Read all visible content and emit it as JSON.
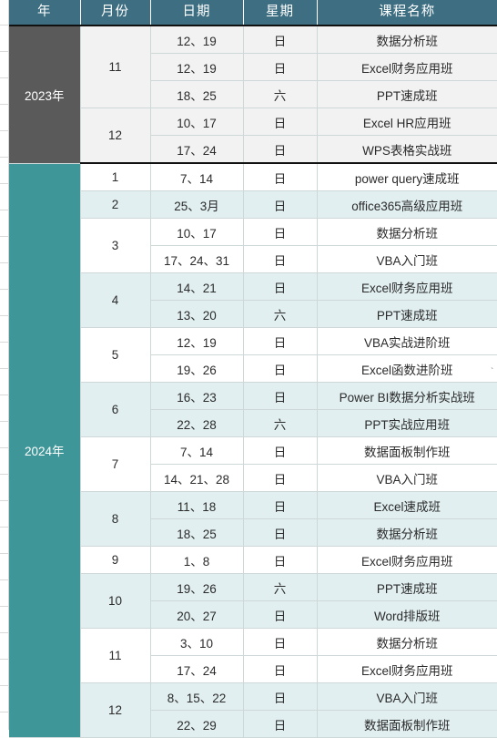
{
  "table": {
    "headers": [
      "年",
      "月份",
      "日期",
      "星期",
      "课程名称"
    ],
    "year_groups": [
      {
        "year_label": "2023年",
        "style": "gray",
        "months": [
          {
            "month": "11",
            "rows": [
              {
                "date": "12、19",
                "week": "日",
                "course": "数据分析班"
              },
              {
                "date": "12、19",
                "week": "日",
                "course": "Excel财务应用班"
              },
              {
                "date": "18、25",
                "week": "六",
                "course": "PPT速成班"
              }
            ]
          },
          {
            "month": "12",
            "rows": [
              {
                "date": "10、17",
                "week": "日",
                "course": "Excel HR应用班"
              },
              {
                "date": "17、24",
                "week": "日",
                "course": "WPS表格实战班"
              }
            ]
          }
        ]
      },
      {
        "year_label": "2024年",
        "style": "teal",
        "months": [
          {
            "month": "1",
            "rows": [
              {
                "date": "7、14",
                "week": "日",
                "course": "power query速成班"
              }
            ]
          },
          {
            "month": "2",
            "rows": [
              {
                "date": "25、3月",
                "week": "日",
                "course": "office365高级应用班"
              }
            ]
          },
          {
            "month": "3",
            "rows": [
              {
                "date": "10、17",
                "week": "日",
                "course": "数据分析班"
              },
              {
                "date": "17、24、31",
                "week": "日",
                "course": "VBA入门班"
              }
            ]
          },
          {
            "month": "4",
            "rows": [
              {
                "date": "14、21",
                "week": "日",
                "course": "Excel财务应用班"
              },
              {
                "date": "13、20",
                "week": "六",
                "course": "PPT速成班"
              }
            ]
          },
          {
            "month": "5",
            "rows": [
              {
                "date": "12、19",
                "week": "日",
                "course": "VBA实战进阶班"
              },
              {
                "date": "19、26",
                "week": "日",
                "course": "Excel函数进阶班"
              }
            ]
          },
          {
            "month": "6",
            "rows": [
              {
                "date": "16、23",
                "week": "日",
                "course": "Power BI数据分析实战班"
              },
              {
                "date": "22、28",
                "week": "六",
                "course": "PPT实战应用班"
              }
            ]
          },
          {
            "month": "7",
            "rows": [
              {
                "date": "7、14",
                "week": "日",
                "course": "数据面板制作班"
              },
              {
                "date": "14、21、28",
                "week": "日",
                "course": "VBA入门班"
              }
            ]
          },
          {
            "month": "8",
            "rows": [
              {
                "date": "11、18",
                "week": "日",
                "course": "Excel速成班"
              },
              {
                "date": "18、25",
                "week": "日",
                "course": "数据分析班"
              }
            ]
          },
          {
            "month": "9",
            "rows": [
              {
                "date": "1、8",
                "week": "日",
                "course": "Excel财务应用班"
              }
            ]
          },
          {
            "month": "10",
            "rows": [
              {
                "date": "19、26",
                "week": "六",
                "course": "PPT速成班"
              },
              {
                "date": "20、27",
                "week": "日",
                "course": "Word排版班"
              }
            ]
          },
          {
            "month": "11",
            "rows": [
              {
                "date": "3、10",
                "week": "日",
                "course": "数据分析班"
              },
              {
                "date": "17、24",
                "week": "日",
                "course": "Excel财务应用班"
              }
            ]
          },
          {
            "month": "12",
            "rows": [
              {
                "date": "8、15、22",
                "week": "日",
                "course": "VBA入门班"
              },
              {
                "date": "22、29",
                "week": "日",
                "course": "数据面板制作班"
              }
            ]
          }
        ]
      }
    ]
  },
  "colors": {
    "header_bg": "#3d6e82",
    "year_2023_bg": "#5a5a5a",
    "year_2024_bg": "#3f9699",
    "row_gray": "#f2f2f2",
    "row_white": "#ffffff",
    "row_cyan": "#e2eff0",
    "grid_line": "#cfd8d8"
  },
  "marks": {
    "stray_cursor": "`"
  }
}
